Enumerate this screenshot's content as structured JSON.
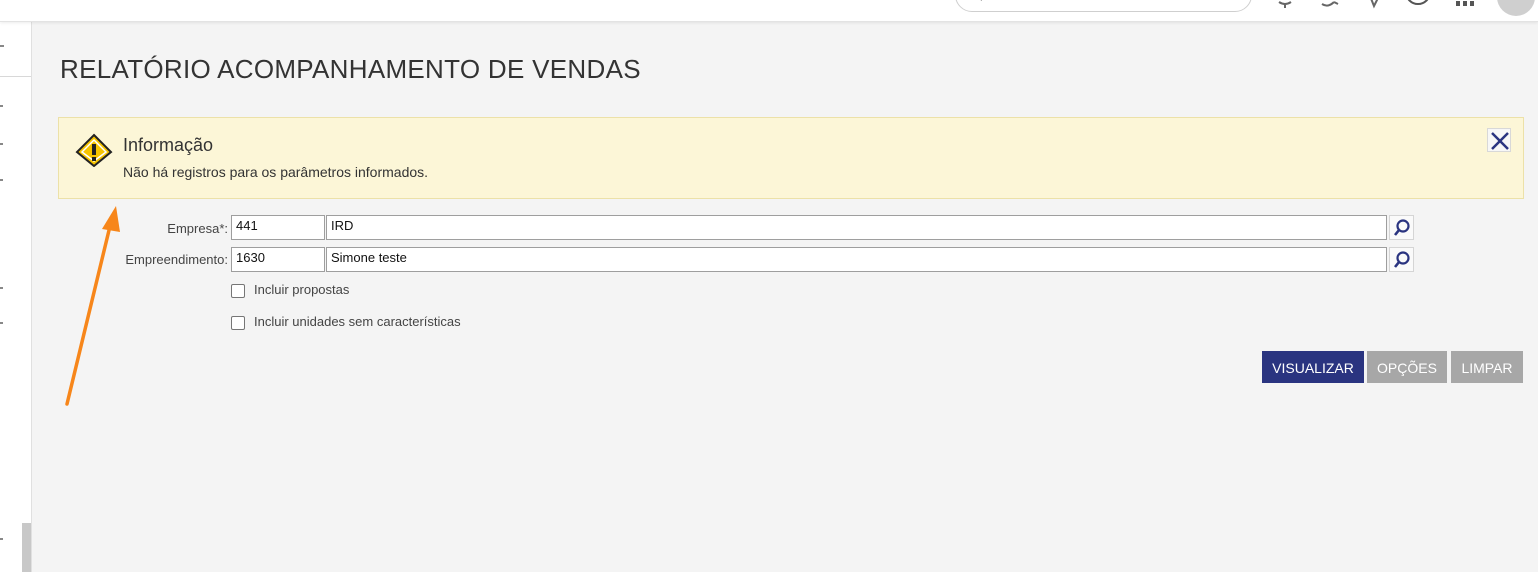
{
  "page": {
    "title": "RELATÓRIO ACOMPANHAMENTO DE VENDAS"
  },
  "info": {
    "title": "Informação",
    "message": "Não há registros para os parâmetros informados."
  },
  "form": {
    "empresa": {
      "label": "Empresa*:",
      "code": "441",
      "name": "IRD"
    },
    "empreendimento": {
      "label": "Empreendimento:",
      "code": "1630",
      "name": "Simone teste"
    },
    "checkboxes": [
      {
        "label": "Incluir propostas",
        "checked": false
      },
      {
        "label": "Incluir unidades sem características",
        "checked": false
      }
    ]
  },
  "actions": {
    "visualizar": "VISUALIZAR",
    "opcoes": "OPÇÕES",
    "limpar": "LIMPAR"
  },
  "colors": {
    "primary": "#2a3480",
    "info_bg": "#fcf6d7",
    "disabled_button": "#a7a7a7",
    "annotation_arrow": "#f7861a"
  }
}
